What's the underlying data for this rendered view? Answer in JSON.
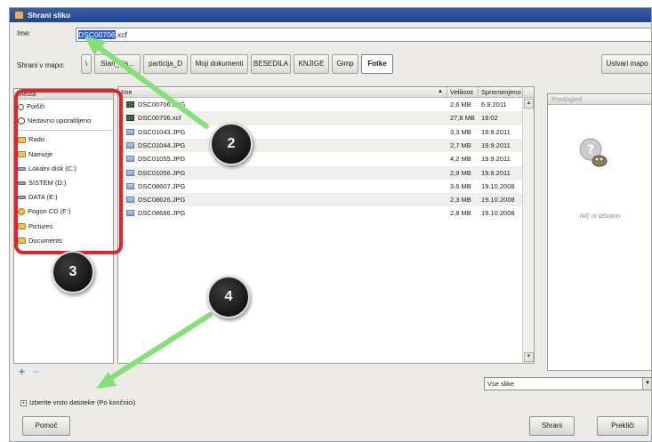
{
  "window": {
    "title": "Shrani sliko"
  },
  "name": {
    "label": "Ime:",
    "selected": "DSC00706",
    "rest": ".xcf"
  },
  "save_in": {
    "label": "Shrani v mapo:",
    "path": [
      "\\",
      "Stari_dis...",
      "particija_D",
      "Moji dokumenti",
      "BESEDILA",
      "KNJIGE",
      "Gimp",
      "Fotke"
    ],
    "create_folder": "Ustvari mapo"
  },
  "places": {
    "header": "Mesta",
    "items": [
      {
        "label": "Poišči",
        "icon": "search-icon"
      },
      {
        "label": "Nedavno uporabljeno",
        "icon": "recent-icon"
      },
      {
        "label": "Rado",
        "icon": "folder-icon"
      },
      {
        "label": "Namizje",
        "icon": "folder-icon"
      },
      {
        "label": "Lokalni disk (C:)",
        "icon": "drive-icon"
      },
      {
        "label": "SISTEM (D:)",
        "icon": "drive-icon"
      },
      {
        "label": "DATA (E:)",
        "icon": "drive-icon"
      },
      {
        "label": "Pogon CD (F:)",
        "icon": "cd-icon"
      },
      {
        "label": "Pictures",
        "icon": "folder-icon"
      },
      {
        "label": "Documents",
        "icon": "folder-icon"
      }
    ],
    "add": "+",
    "remove": "−"
  },
  "files": {
    "headers": {
      "name": "Ime",
      "size": "Velikost",
      "modified": "Spremenjeno"
    },
    "rows": [
      {
        "name": "DSC00706.JPG",
        "size": "2,6 MB",
        "modified": "6.9.2011",
        "icon": "image-icon"
      },
      {
        "name": "DSC00706.xcf",
        "size": "27,8 MB",
        "modified": "19:02",
        "icon": "image-icon"
      },
      {
        "name": "DSC01043.JPG",
        "size": "3,3 MB",
        "modified": "19.9.2011",
        "icon": "file-icon"
      },
      {
        "name": "DSC01044.JPG",
        "size": "2,7 MB",
        "modified": "19.9.2011",
        "icon": "file-icon"
      },
      {
        "name": "DSC01055.JPG",
        "size": "4,2 MB",
        "modified": "19.9.2011",
        "icon": "file-icon"
      },
      {
        "name": "DSC01056.JPG",
        "size": "2,9 MB",
        "modified": "19.9.2011",
        "icon": "file-icon"
      },
      {
        "name": "DSC08607.JPG",
        "size": "3,6 MB",
        "modified": "19.10.2008",
        "icon": "file-icon"
      },
      {
        "name": "DSC08626.JPG",
        "size": "2,3 MB",
        "modified": "19.10.2008",
        "icon": "file-icon"
      },
      {
        "name": "DSC08686.JPG",
        "size": "2,8 MB",
        "modified": "19.10.2008",
        "icon": "file-icon"
      }
    ]
  },
  "preview": {
    "header": "Predogled",
    "empty_text": "Nič ni izbrano"
  },
  "filter": {
    "value": "Vse slike"
  },
  "file_type": {
    "label": "Izberite vrsto datoteke (Po končnici)",
    "toggle": "+"
  },
  "buttons": {
    "help": "Pomoč",
    "save": "Shrani",
    "cancel": "Prekliči"
  },
  "annotations": {
    "badges": [
      "2",
      "3",
      "4"
    ],
    "highlight_color": "#e0242b",
    "arrow_color": "#86e07a"
  }
}
